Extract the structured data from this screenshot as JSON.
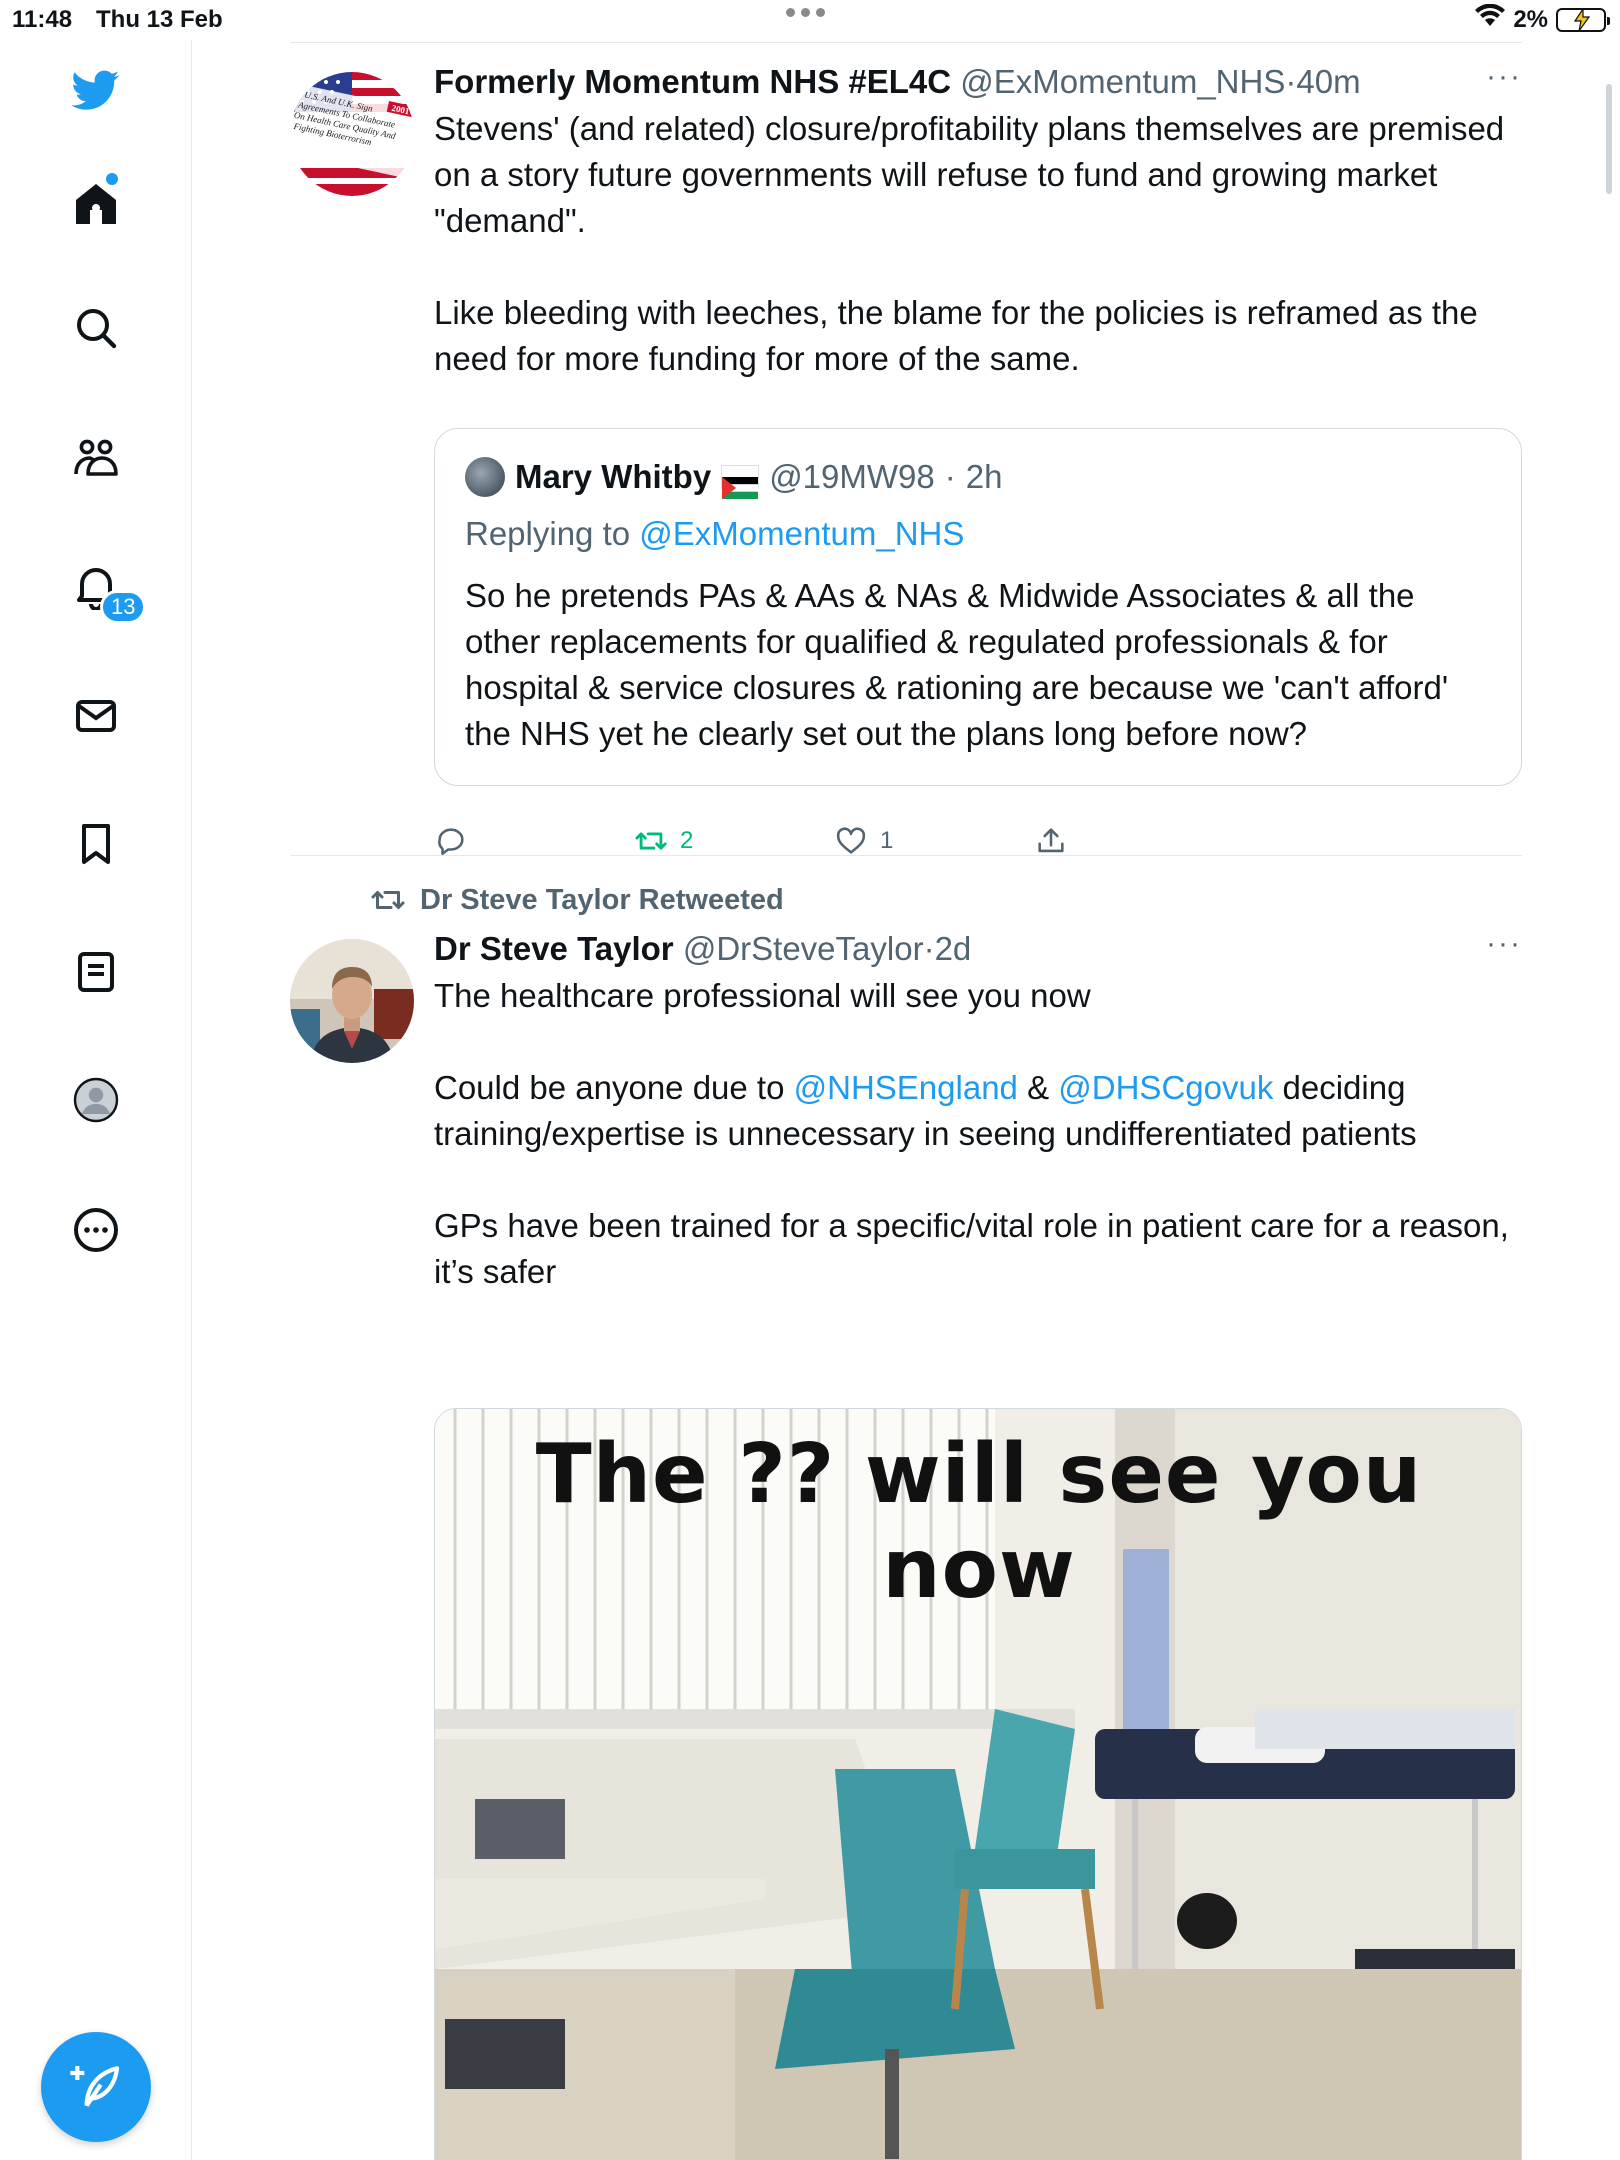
{
  "status_bar": {
    "time": "11:48",
    "date": "Thu 13 Feb",
    "battery": "2%"
  },
  "sidebar": {
    "items": [
      {
        "name": "home",
        "icon": "home-icon"
      },
      {
        "name": "explore",
        "icon": "search-icon"
      },
      {
        "name": "communities",
        "icon": "communities-icon"
      },
      {
        "name": "notifications",
        "icon": "bell-icon",
        "badge": "13"
      },
      {
        "name": "messages",
        "icon": "mail-icon"
      },
      {
        "name": "bookmarks",
        "icon": "bookmark-icon"
      },
      {
        "name": "lists",
        "icon": "list-icon"
      },
      {
        "name": "profile",
        "icon": "profile-icon"
      },
      {
        "name": "more",
        "icon": "more-circle-icon"
      }
    ],
    "compose_icon": "compose-icon",
    "brand_color": "#1d9bf0"
  },
  "tweet1": {
    "name": "Formerly Momentum NHS #EL4C",
    "handle": "@ExMomentum_NHS",
    "time": "40m",
    "text": "Stevens' (and related) closure/profitability plans themselves are premised on a story future governments will refuse to fund and growing market \"demand\".\n\nLike bleeding with leeches, the blame for the policies is reframed as the need for more funding for more of the same.",
    "avatar_lines": [
      "U.S. And U.K. Sign",
      "Agreements To Collaborate",
      "On Health Care Quality And",
      "Fighting Bioterrorism",
      "2001"
    ],
    "quote": {
      "name": "Mary Whitby",
      "handle": "@19MW98",
      "time": "2h",
      "replying_prefix": "Replying to",
      "replying_to": "@ExMomentum_NHS",
      "text": "So he pretends PAs & AAs & NAs & Midwide Associates & all the other replacements for qualified & regulated professionals & for hospital & service closures & rationing are because we 'can't afford' the NHS yet he clearly set out the plans long before now?"
    },
    "actions": {
      "reply_count": "",
      "retweet_count": "2",
      "like_count": "1"
    }
  },
  "tweet2": {
    "retweeted_by": "Dr Steve Taylor Retweeted",
    "name": "Dr Steve Taylor",
    "handle": "@DrSteveTaylor",
    "time": "2d",
    "text_line1": "The healthcare professional will see you now",
    "text_p2_a": "Could be anyone due to ",
    "mention1": "@NHSEngland",
    "text_p2_b": " & ",
    "mention2": "@DHSCgovuk",
    "text_p2_c": " deciding training/expertise is unnecessary in seeing undifferentiated patients",
    "text_p3": "GPs have been trained for a specific/vital role in patient care for a reason,\nit’s safer",
    "media_caption": "The ?? will see you now"
  }
}
